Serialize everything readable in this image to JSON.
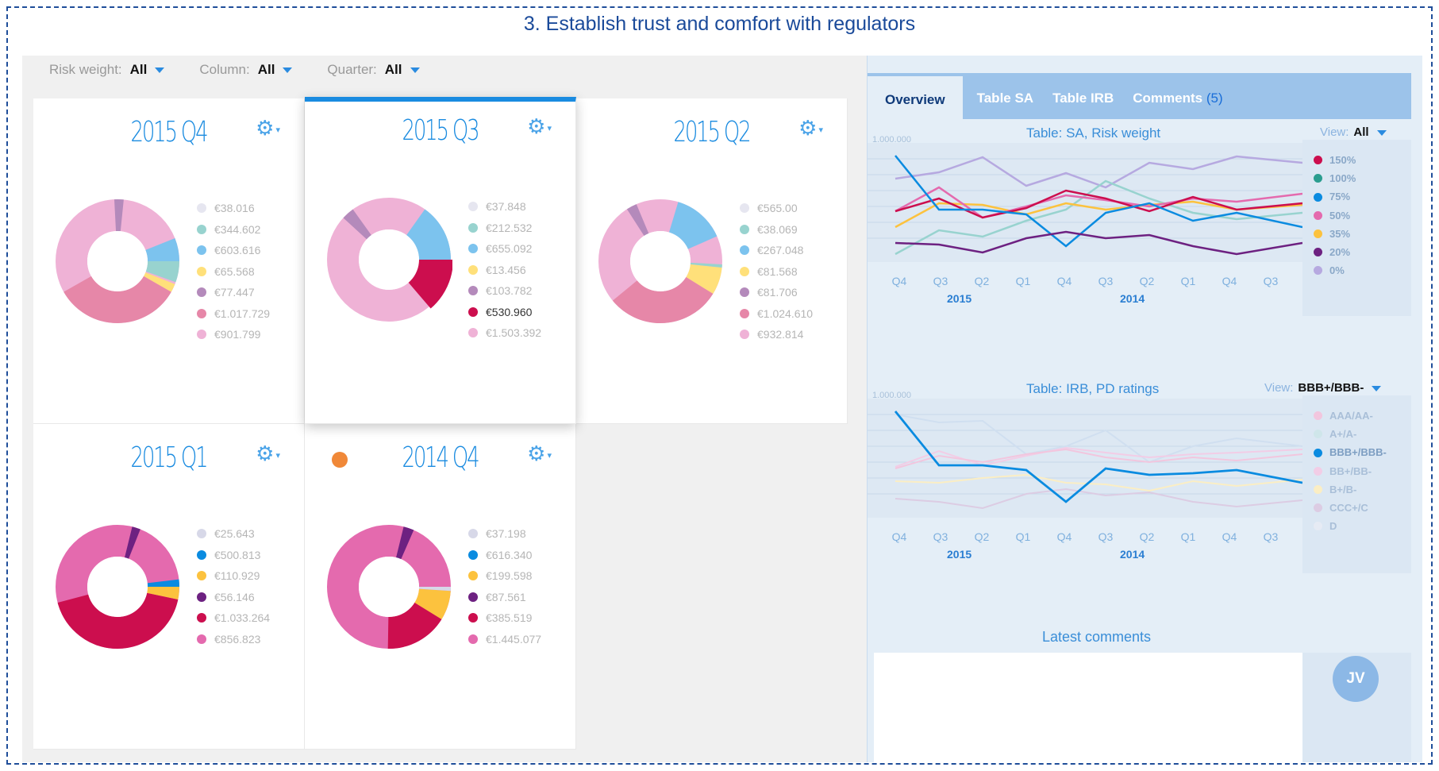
{
  "page_title": "3. Establish trust and comfort with regulators",
  "filters": [
    {
      "label": "Risk weight:",
      "value": "All"
    },
    {
      "label": "Column:",
      "value": "All"
    },
    {
      "label": "Quarter:",
      "value": "All"
    }
  ],
  "cards": [
    {
      "title": "2015 Q4",
      "legend": [
        {
          "value": "€38.016",
          "color": "#e6e6f0"
        },
        {
          "value": "€344.602",
          "color": "#98d3cf"
        },
        {
          "value": "€603.616",
          "color": "#7cc3ee"
        },
        {
          "value": "€65.568",
          "color": "#ffe07a"
        },
        {
          "value": "€77.447",
          "color": "#b48abb"
        },
        {
          "value": "€1.017.729",
          "color": "#e687a8"
        },
        {
          "value": "€901.799",
          "color": "#efb2d6"
        }
      ]
    },
    {
      "title": "2015 Q3",
      "legend": [
        {
          "value": "€37.848",
          "color": "#e6e6f0"
        },
        {
          "value": "€212.532",
          "color": "#98d3cf"
        },
        {
          "value": "€655.092",
          "color": "#7cc3ee"
        },
        {
          "value": "€13.456",
          "color": "#ffe07a"
        },
        {
          "value": "€103.782",
          "color": "#b48abb"
        },
        {
          "value": "€530.960",
          "color": "#cc0e4e"
        },
        {
          "value": "€1.503.392",
          "color": "#efb2d6"
        }
      ]
    },
    {
      "title": "2015 Q2",
      "legend": [
        {
          "value": "€565.00",
          "color": "#e6e6f0"
        },
        {
          "value": "€38.069",
          "color": "#98d3cf"
        },
        {
          "value": "€267.048",
          "color": "#7cc3ee"
        },
        {
          "value": "€81.568",
          "color": "#ffe07a"
        },
        {
          "value": "€81.706",
          "color": "#b48abb"
        },
        {
          "value": "€1.024.610",
          "color": "#e687a8"
        },
        {
          "value": "€932.814",
          "color": "#efb2d6"
        }
      ]
    },
    {
      "title": "2015 Q1",
      "legend": [
        {
          "value": "€25.643",
          "color": "#d7d8e8"
        },
        {
          "value": "€500.813",
          "color": "#0a8be0"
        },
        {
          "value": "€110.929",
          "color": "#fcc23e"
        },
        {
          "value": "€56.146",
          "color": "#6d2181"
        },
        {
          "value": "€1.033.264",
          "color": "#cc0e4e"
        },
        {
          "value": "€856.823",
          "color": "#e46aae"
        }
      ]
    },
    {
      "title": "2014 Q4",
      "legend": [
        {
          "value": "€37.198",
          "color": "#d7d8e8"
        },
        {
          "value": "€616.340",
          "color": "#0a8be0"
        },
        {
          "value": "€199.598",
          "color": "#fcc23e"
        },
        {
          "value": "€87.561",
          "color": "#6d2181"
        },
        {
          "value": "€385.519",
          "color": "#cc0e4e"
        },
        {
          "value": "€1.445.077",
          "color": "#e46aae"
        }
      ]
    }
  ],
  "tabs": [
    {
      "label": "Overview"
    },
    {
      "label": "Table SA"
    },
    {
      "label": "Table IRB"
    },
    {
      "label": "Comments",
      "count": "(5)"
    }
  ],
  "chart_sa": {
    "title": "Table: SA, Risk weight",
    "view_label": "View:",
    "view_value": "All",
    "ymax_label": "1.000.000",
    "x_ticks": [
      "Q4",
      "Q3",
      "Q2",
      "Q1",
      "Q4",
      "Q3",
      "Q2",
      "Q1",
      "Q4",
      "Q3"
    ],
    "years": [
      "2015",
      "2014"
    ],
    "legend": [
      {
        "label": "150%",
        "color": "#cc0e4e"
      },
      {
        "label": "100%",
        "color": "#2a9d8f"
      },
      {
        "label": "75%",
        "color": "#0a8be0"
      },
      {
        "label": "50%",
        "color": "#e46aae"
      },
      {
        "label": "35%",
        "color": "#fcc23e"
      },
      {
        "label": "20%",
        "color": "#6d2181"
      },
      {
        "label": "0%",
        "color": "#b6a9e0"
      }
    ]
  },
  "chart_irb": {
    "title": "Table: IRB, PD ratings",
    "view_label": "View:",
    "view_value": "BBB+/BBB-",
    "ymax_label": "1.000.000",
    "x_ticks": [
      "Q4",
      "Q3",
      "Q2",
      "Q1",
      "Q4",
      "Q3",
      "Q2",
      "Q1",
      "Q4",
      "Q3"
    ],
    "years": [
      "2015",
      "2014"
    ],
    "legend": [
      {
        "label": "AAA/AA-",
        "color": "#f2c6de"
      },
      {
        "label": "A+/A-",
        "color": "#cfe6ea"
      },
      {
        "label": "BBB+/BBB-",
        "color": "#0a8be0"
      },
      {
        "label": "BB+/BB-",
        "color": "#f2cde6"
      },
      {
        "label": "B+/B-",
        "color": "#fbeec4"
      },
      {
        "label": "CCC+/C",
        "color": "#dccce3"
      },
      {
        "label": "D",
        "color": "#e6ebf4"
      }
    ]
  },
  "comments": {
    "title": "Latest comments",
    "avatar": "JV"
  }
}
